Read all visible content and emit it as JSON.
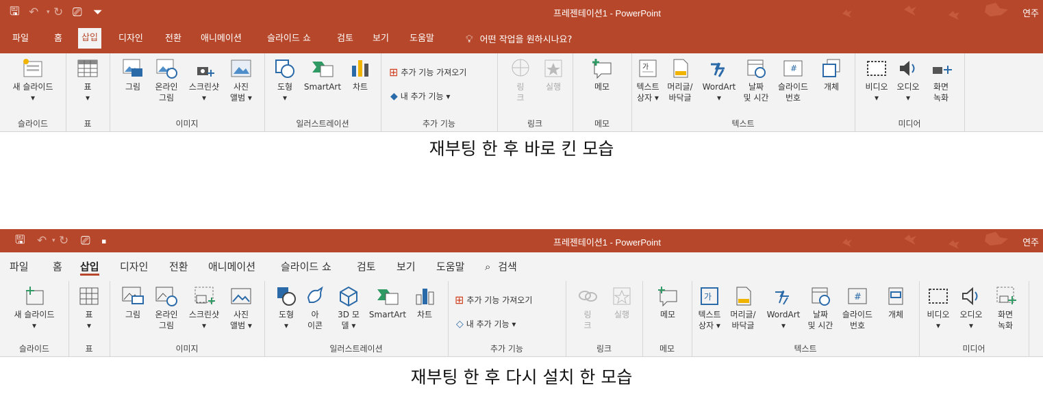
{
  "panel1": {
    "window_title": "프레젠테이션1 - PowerPoint",
    "user": "연주",
    "tabs": [
      "파일",
      "홈",
      "삽입",
      "디자인",
      "전환",
      "애니메이션",
      "슬라이드 쇼",
      "검토",
      "보기",
      "도움말"
    ],
    "tell_me": "어떤 작업을 원하시나요?",
    "caption": "재부팅 한 후 바로 킨 모습"
  },
  "panel2": {
    "window_title": "프레젠테이션1 - PowerPoint",
    "user": "연주",
    "tabs": [
      "파일",
      "홈",
      "삽입",
      "디자인",
      "전환",
      "애니메이션",
      "슬라이드 쇼",
      "검토",
      "보기",
      "도움말"
    ],
    "search": "검색",
    "caption": "재부팅 한 후 다시 설치 한 모습"
  },
  "ribbon": {
    "new_slide": "새 슬라이드",
    "table": "표",
    "picture": "그림",
    "online_picture": "온라인\n그림",
    "screenshot": "스크린샷",
    "photo_album": "사진\n앨범 ▾",
    "shapes": "도형",
    "icons": "아\n이콘",
    "models_3d": "3D 모\n델 ▾",
    "smartart": "SmartArt",
    "chart": "차트",
    "get_addins": "추가 기능 가져오기",
    "my_addins": "내 추가 기능  ▾",
    "link": "링\n크",
    "action": "실행",
    "comment": "메모",
    "textbox": "텍스트\n상자 ▾",
    "header_footer": "머리글/\n바닥글",
    "wordart": "WordArt",
    "date_time": "날짜\n및 시간",
    "slide_number": "슬라이드\n번호",
    "object": "개체",
    "video": "비디오",
    "audio": "오디오",
    "screen_record": "화면\n녹화",
    "dropdown": "▾",
    "groups": {
      "slides": "슬라이드",
      "tables": "표",
      "images": "이미지",
      "illustrations": "일러스트레이션",
      "addins": "추가 기능",
      "links": "링크",
      "comments": "메모",
      "text": "텍스트",
      "media": "미디어"
    }
  }
}
